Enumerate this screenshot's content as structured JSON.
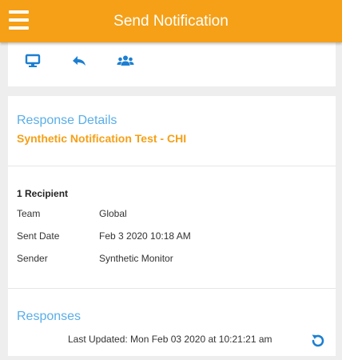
{
  "header": {
    "title": "Send Notification"
  },
  "toolbar": {
    "items": [
      {
        "icon": "monitor-icon"
      },
      {
        "icon": "reply-icon"
      },
      {
        "icon": "group-icon"
      }
    ]
  },
  "details": {
    "section_title": "Response Details",
    "notification_name": "Synthetic Notification Test - CHI",
    "recipient_count": "1 Recipient",
    "fields": [
      {
        "label": "Team",
        "value": "Global"
      },
      {
        "label": "Sent Date",
        "value": "Feb 3 2020 10:18 AM"
      },
      {
        "label": "Sender",
        "value": "Synthetic Monitor"
      }
    ]
  },
  "responses": {
    "section_title": "Responses",
    "last_updated": "Last Updated: Mon Feb 03 2020 at 10:21:21 am",
    "refresh_icon": "refresh-icon"
  },
  "colors": {
    "header": "#f5a017",
    "accent_blue": "#1c7fd1",
    "section_title": "#5aaee8",
    "background": "#eeeeee"
  }
}
